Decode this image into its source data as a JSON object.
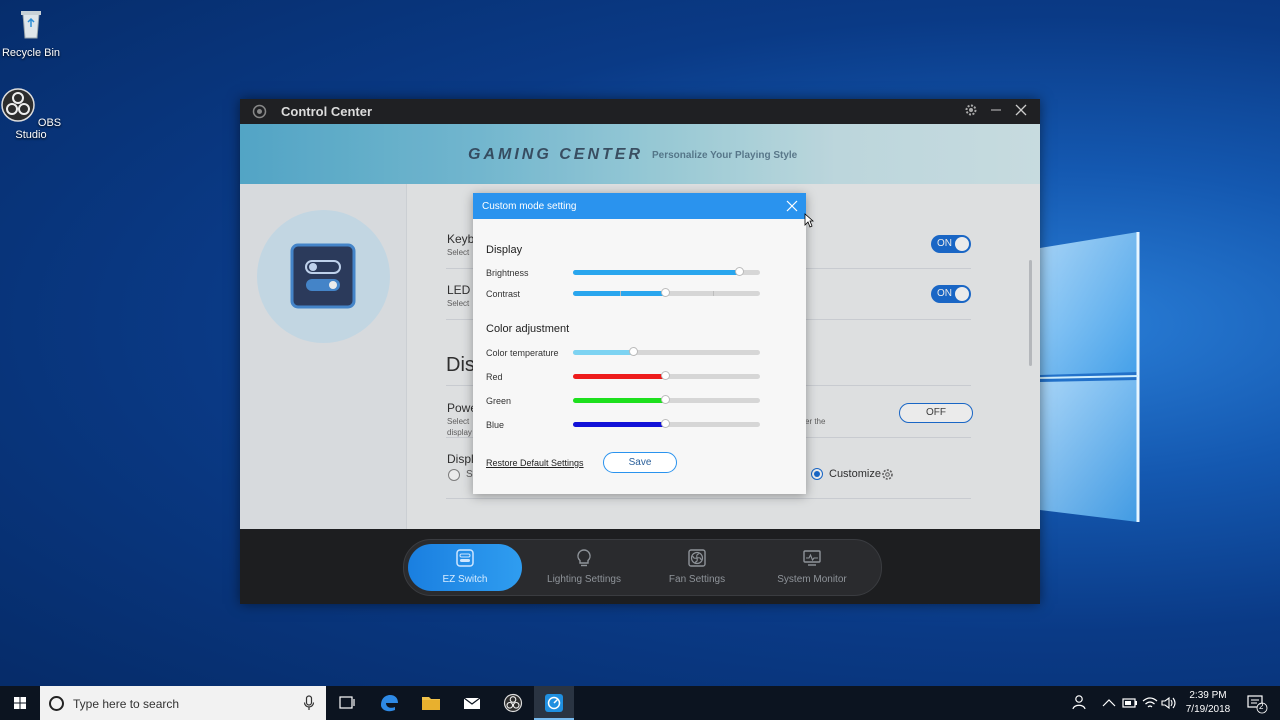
{
  "desktop": {
    "icons": [
      {
        "label": "Recycle Bin",
        "icon": "recycle-bin-icon"
      },
      {
        "label": "OBS Studio",
        "icon": "obs-studio-icon"
      }
    ]
  },
  "app": {
    "title": "Control Center",
    "banner": {
      "brand": "GAMING CENTER",
      "tagline": "Personalize Your Playing Style"
    },
    "rows": [
      {
        "label": "Keyb",
        "sub": "Select",
        "state": "ON"
      },
      {
        "label": "LED L",
        "sub": "Select",
        "state": "ON"
      }
    ],
    "section_heading": "Dis",
    "power_row": {
      "label": "Powe",
      "sub1": "Select",
      "sub2": "display",
      "sub_right": "er the",
      "state": "OFF"
    },
    "display_row": {
      "label": "Displ",
      "option_left": "St",
      "option_selected": "Customize"
    },
    "nav": [
      {
        "label": "EZ Switch",
        "icon": "ez-switch-icon",
        "active": true
      },
      {
        "label": "Lighting Settings",
        "icon": "lightbulb-icon",
        "active": false
      },
      {
        "label": "Fan Settings",
        "icon": "fan-icon",
        "active": false
      },
      {
        "label": "System Monitor",
        "icon": "monitor-icon",
        "active": false
      }
    ]
  },
  "dialog": {
    "title": "Custom mode setting",
    "display_heading": "Display",
    "color_heading": "Color adjustment",
    "sliders": {
      "brightness": {
        "label": "Brightness",
        "value": 0.89,
        "color": "#29a6ee"
      },
      "contrast": {
        "label": "Contrast",
        "value": 0.49,
        "color": "#29a6ee"
      },
      "color_temperature": {
        "label": "Color temperature",
        "value": 0.32,
        "color": "#7dd3f2"
      },
      "red": {
        "label": "Red",
        "value": 0.49,
        "color": "#ee1c1c"
      },
      "green": {
        "label": "Green",
        "value": 0.49,
        "color": "#1ee01e"
      },
      "blue": {
        "label": "Blue",
        "value": 0.49,
        "color": "#1212d8"
      }
    },
    "restore_label": "Restore Default Settings",
    "save_label": "Save"
  },
  "taskbar": {
    "search_placeholder": "Type here to search",
    "time": "2:39 PM",
    "date": "7/19/2018",
    "notification_count": "2"
  }
}
